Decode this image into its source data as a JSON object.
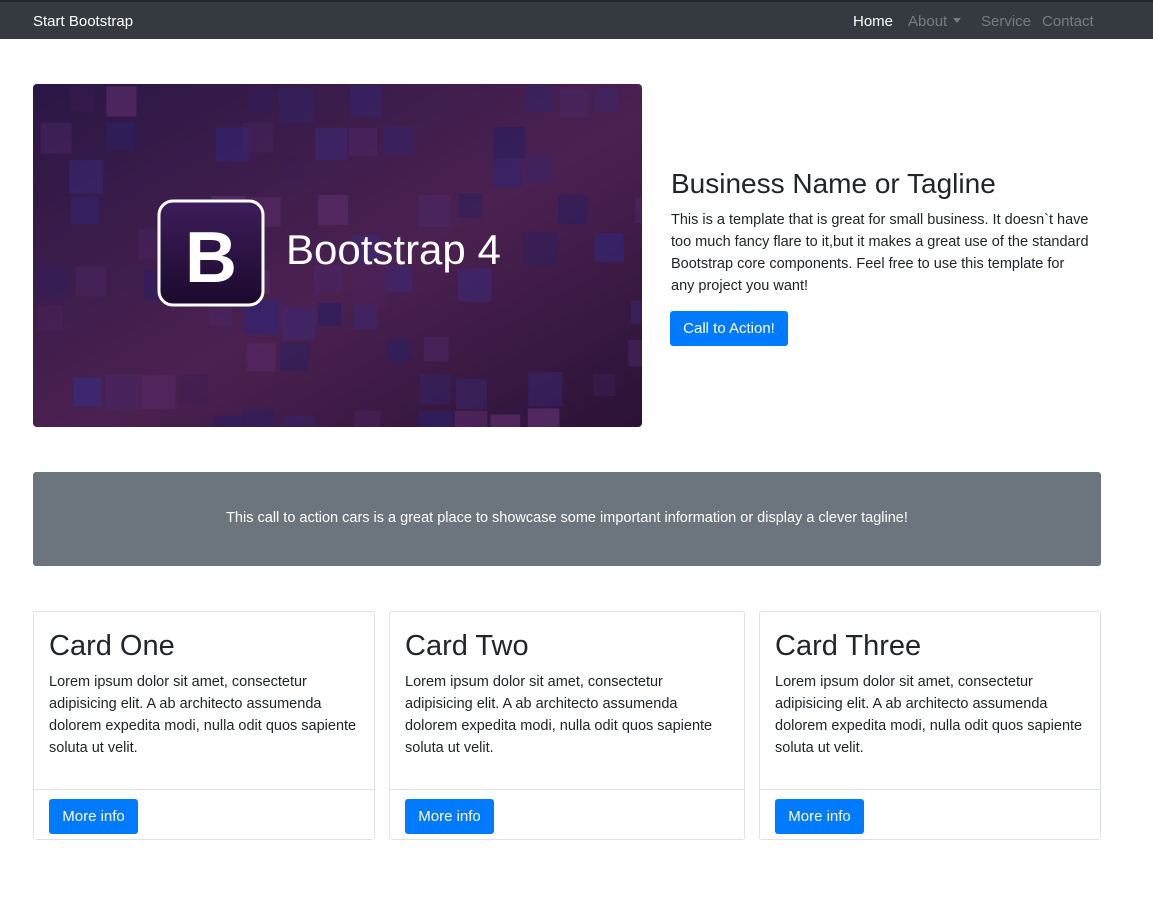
{
  "navbar": {
    "brand": "Start Bootstrap",
    "items": [
      {
        "label": "Home"
      },
      {
        "label": "About"
      },
      {
        "label": "Service"
      },
      {
        "label": "Contact"
      }
    ]
  },
  "hero": {
    "image_text": "Bootstrap 4",
    "image_logo_letter": "B",
    "title": "Business Name or Tagline",
    "text": "This is a template that is great for small business. It doesn`t have too much fancy flare to it,but it makes a great use of the standard Bootstrap core components. Feel free to use this template for any project you want!",
    "button_label": "Call to Action!"
  },
  "callout": {
    "text": "This call to action cars is a great place to showcase some important information or display a clever tagline!"
  },
  "cards": [
    {
      "title": "Card One",
      "text": "Lorem ipsum dolor sit amet, consectetur adipisicing elit. A ab architecto assumenda dolorem expedita modi, nulla odit quos sapiente soluta ut velit.",
      "button_label": "More info"
    },
    {
      "title": "Card Two",
      "text": "Lorem ipsum dolor sit amet, consectetur adipisicing elit. A ab architecto assumenda dolorem expedita modi, nulla odit quos sapiente soluta ut velit.",
      "button_label": "More info"
    },
    {
      "title": "Card Three",
      "text": "Lorem ipsum dolor sit amet, consectetur adipisicing elit. A ab architecto assumenda dolorem expedita modi, nulla odit quos sapiente soluta ut velit.",
      "button_label": "More info"
    }
  ],
  "colors": {
    "navbar_bg": "#343a40",
    "primary": "#007bff",
    "callout_bg": "#6c757d",
    "hero_bg_dark": "#2a1340",
    "hero_bg_light": "#5a2a5e"
  }
}
